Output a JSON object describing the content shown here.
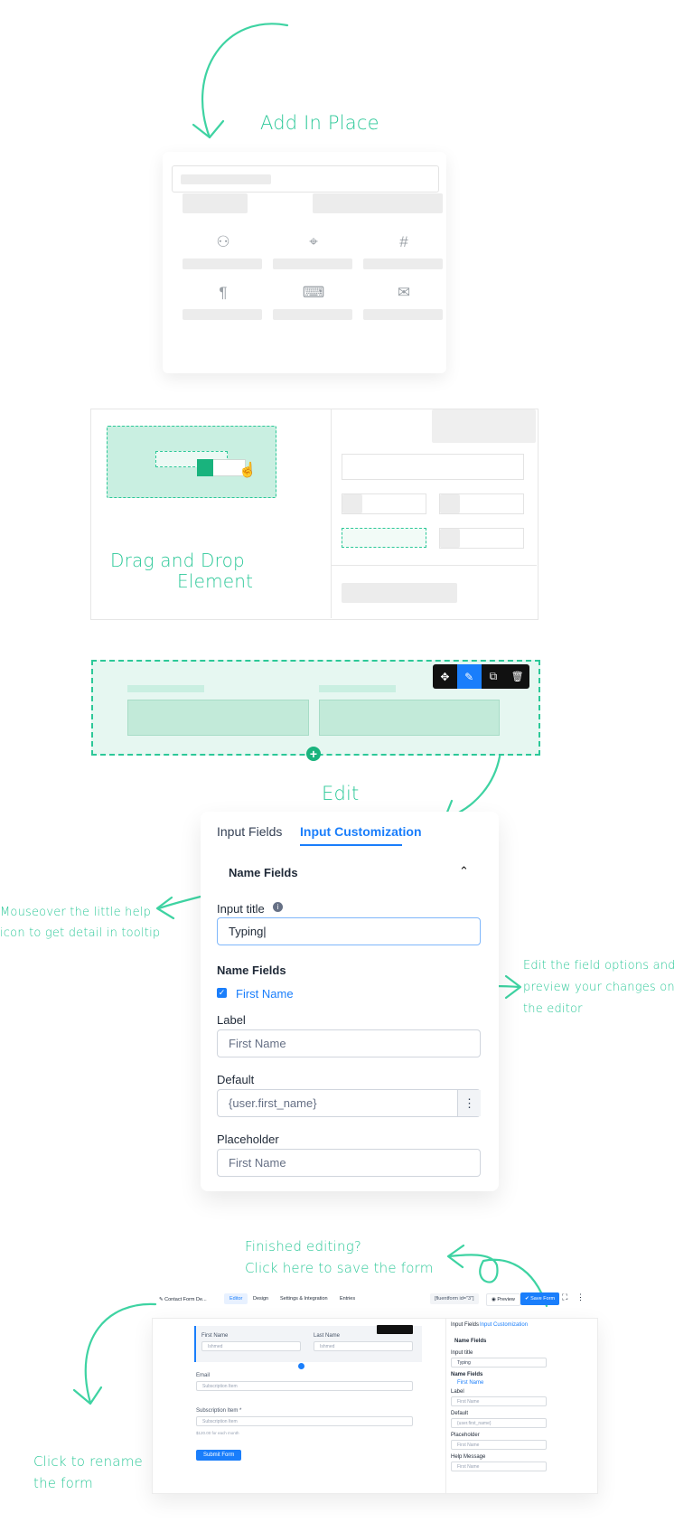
{
  "annotations": {
    "add_in_place": "Add In Place",
    "drag_drop_line1": "Drag and Drop",
    "drag_drop_line2": "Element",
    "edit": "Edit",
    "mouseover_line1": "Mouseover the little help",
    "mouseover_line2": "icon to get detail in tooltip",
    "edit_options_line1": "Edit the field options and",
    "edit_options_line2": "preview your changes on",
    "edit_options_line3": "the editor",
    "finished_line1": "Finished editing?",
    "finished_line2": "Click here to save the form",
    "rename_line1": "Click to rename",
    "rename_line2": "the form"
  },
  "colors": {
    "accent_green": "#2cc898",
    "accent_blue": "#1a7efb",
    "toolbar_bg": "#111111"
  },
  "add_in_place_panel": {
    "icons": [
      "user-icon",
      "map-pin-icon",
      "hash-icon",
      "paragraph-icon",
      "keyboard-icon",
      "mail-icon"
    ],
    "glyphs": [
      "⚇",
      "⌖",
      "#",
      "¶",
      "⌨",
      "✉"
    ]
  },
  "editor_toolbar": {
    "icons": [
      "move-icon",
      "edit-icon",
      "copy-icon",
      "trash-icon"
    ],
    "glyphs": [
      "✥",
      "✎",
      "⧉",
      "🗑"
    ]
  },
  "customization_panel": {
    "tabs": [
      "Input Fields",
      "Input Customization"
    ],
    "section_title": "Name Fields",
    "input_title_label": "Input title",
    "input_title_value": "Typing|",
    "name_fields_label": "Name Fields",
    "first_name_checkbox": "First Name",
    "label_label": "Label",
    "label_value": "First Name",
    "default_label": "Default",
    "default_value": "{user.first_name}",
    "placeholder_label": "Placeholder",
    "placeholder_value": "First Name"
  },
  "form_editor": {
    "form_name": "Contact Form De...",
    "tabs": [
      "Editor",
      "Design",
      "Settings & Integration",
      "Entries"
    ],
    "shortcode": "[fluentform id=\"3\"]",
    "preview": "Preview",
    "save": "Save Form",
    "first_name_label": "First Name",
    "first_name_value": "Ishmed",
    "last_name_label": "Last Name",
    "last_name_value": "Ishmed",
    "email_label": "Email",
    "email_placeholder": "Subscription Item",
    "subscription_label": "Subscription Item *",
    "subscription_placeholder": "Subscription Item",
    "subscription_note": "$120.00 for each month",
    "submit": "Submit Form",
    "side_tabs": [
      "Input Fields",
      "Input Customization"
    ],
    "side_section": "Name Fields",
    "side_input_title": "Input title",
    "side_input_value": "Typing",
    "side_name_fields": "Name Fields",
    "side_first_name": "First Name",
    "side_label": "Label",
    "side_label_value": "First Name",
    "side_default": "Default",
    "side_default_value": "{user.first_name}",
    "side_placeholder": "Placeholder",
    "side_placeholder_value": "First Name",
    "side_help": "Help Message",
    "side_help_value": "First Name"
  }
}
